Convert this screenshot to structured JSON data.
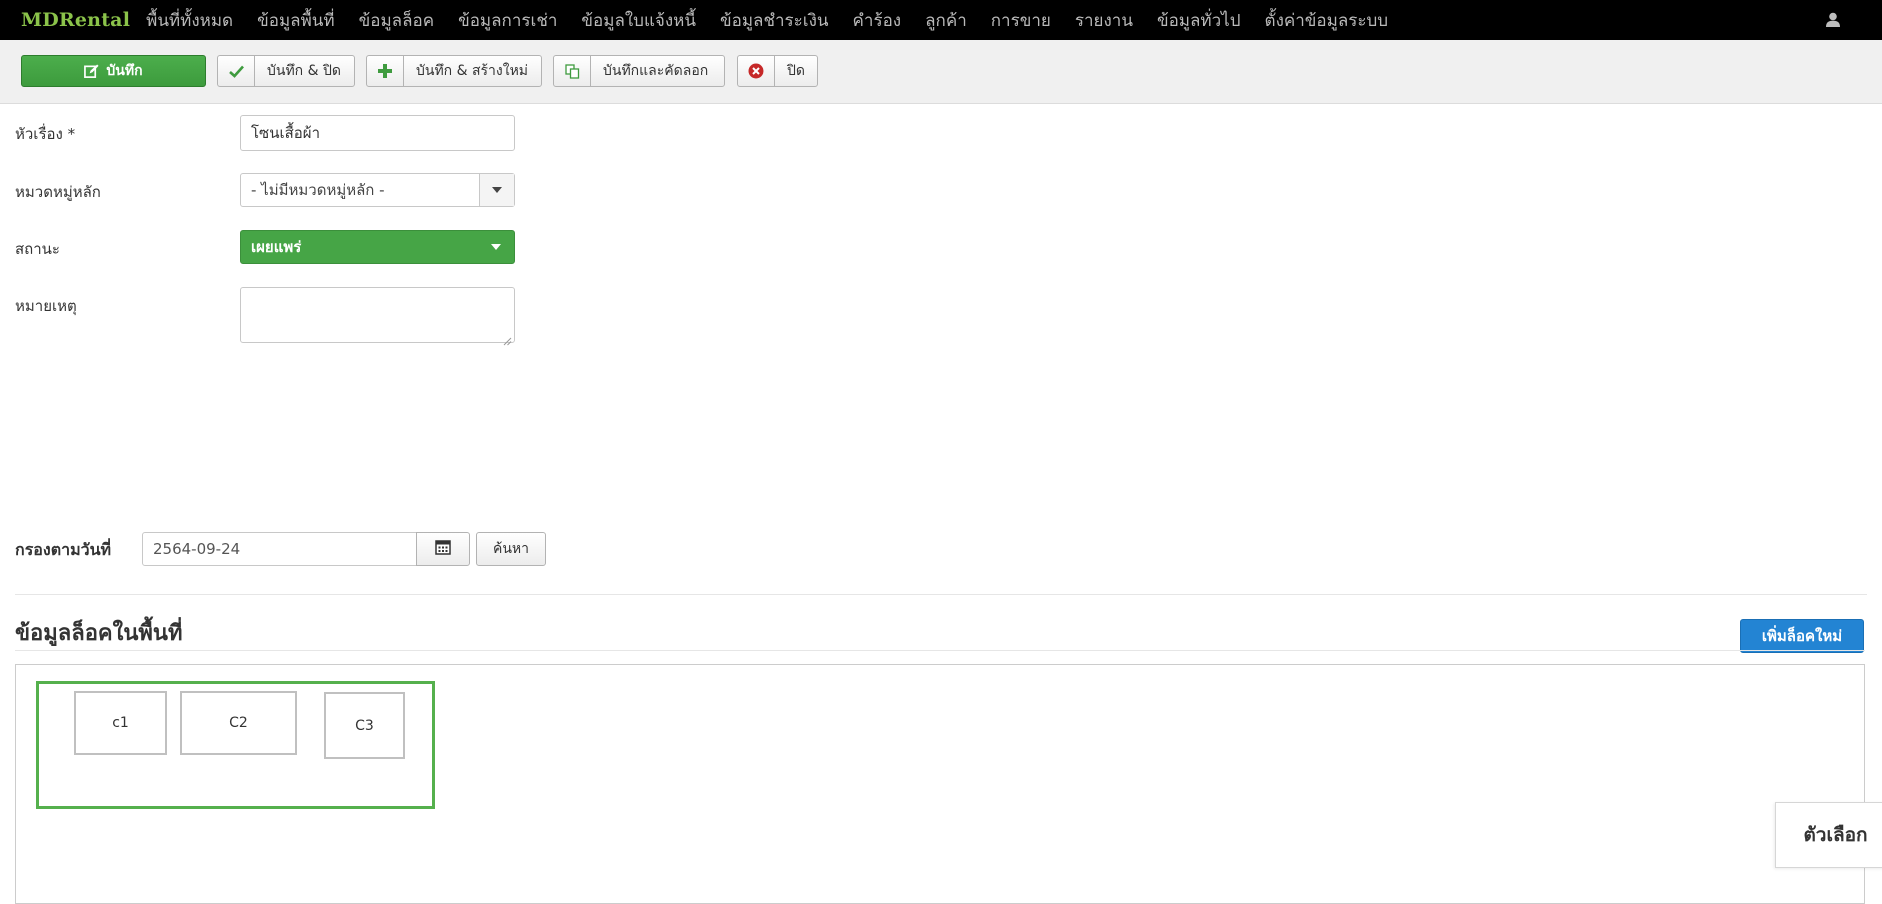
{
  "app": {
    "brand": "MDRental",
    "nav": [
      "พื้นที่ทั้งหมด",
      "ข้อมูลพื้นที่",
      "ข้อมูลล็อค",
      "ข้อมูลการเช่า",
      "ข้อมูลใบแจ้งหนี้",
      "ข้อมูลชำระเงิน",
      "คำร้อง",
      "ลูกค้า",
      "การขาย",
      "รายงาน",
      "ข้อมูลทั่วไป",
      "ตั้งค่าข้อมูลระบบ"
    ],
    "user_icon": "user-icon"
  },
  "toolbar": {
    "save": "บันทึก",
    "save_close": "บันทึก & ปิด",
    "save_new": "บันทึก & สร้างใหม่",
    "save_copy": "บันทึกและคัดลอก",
    "close": "ปิด"
  },
  "form": {
    "title_label": "หัวเรื่อง *",
    "title_value": "โซนเสื้อผ้า",
    "category_label": "หมวดหมู่หลัก",
    "category_value": "- ไม่มีหมวดหมู่หลัก -",
    "status_label": "สถานะ",
    "status_value": "เผยแพร่",
    "note_label": "หมายเหตุ",
    "note_value": ""
  },
  "filter": {
    "label": "กรองตามวันที่",
    "date_value": "2564-09-24",
    "search_button": "ค้นหา"
  },
  "section": {
    "title": "ข้อมูลล็อคในพื้นที่",
    "add_button": "เพิ่มล็อคใหม่",
    "locks": [
      "c1",
      "C2",
      "C3"
    ]
  },
  "options_tab": "ตัวเลือก",
  "colors": {
    "brand": "#8bc34a",
    "save_green": "#46a546",
    "add_blue": "#2384d3",
    "zone_border": "#55b04d",
    "close_red": "#c62828"
  }
}
